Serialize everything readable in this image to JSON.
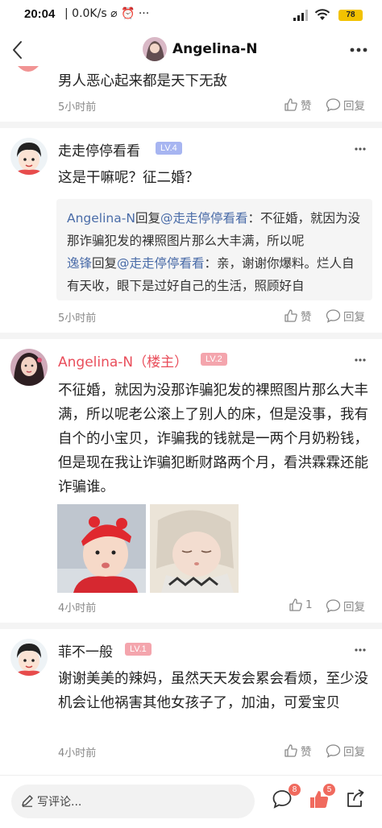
{
  "status_bar": {
    "time": "20:04",
    "network": "| 0.0K/s ⌀ ⏰ ···",
    "battery": "78"
  },
  "header": {
    "title": "Angelina-N"
  },
  "actions": {
    "like": "赞",
    "reply": "回复"
  },
  "comments": [
    {
      "text": "男人恶心起来都是天下无敌",
      "time": "5小时前"
    },
    {
      "user": "走走停停看看",
      "level": "LV.4",
      "text": "这是干嘛呢？征二婚？",
      "replies": [
        {
          "from": "Angelina-N",
          "verb": "回复",
          "to": "@走走停停看看",
          "content": "：不征婚，就因为没那诈骗犯发的裸照图片那么大丰满，所以呢"
        },
        {
          "from": "逸锋",
          "verb": "回复",
          "to": "@走走停停看看",
          "content": "：亲，谢谢你爆料。烂人自有天收，眼下是过好自己的生活，照顾好自"
        }
      ],
      "time": "5小时前"
    },
    {
      "user": "Angelina-N（楼主）",
      "level": "LV.2",
      "text": "不征婚，就因为没那诈骗犯发的裸照图片那么大丰满，所以呢老公滚上了别人的床，但是没事，我有自个的小宝贝，诈骗我的钱就是一两个月奶粉钱，但是现在我让诈骗犯断财路两个月，看洪霖霖还能诈骗谁。",
      "time": "4小时前",
      "like_count": "1"
    },
    {
      "user": "菲不一般",
      "level": "LV.1",
      "text": "谢谢美美的辣妈，虽然天天发会累会看烦，至少没机会让他祸害其他女孩子了，加油，可爱宝贝",
      "time": "4小时前"
    }
  ],
  "bottom_bar": {
    "write_placeholder": "写评论...",
    "comment_badge": "8",
    "like_badge": "5"
  },
  "colors": {
    "host_name": "#e94e5b",
    "reply_link": "#4a6ca8",
    "level_blue": "#a7b5f1",
    "level_pink": "#f4a5ad",
    "badge": "#f06a5e"
  }
}
